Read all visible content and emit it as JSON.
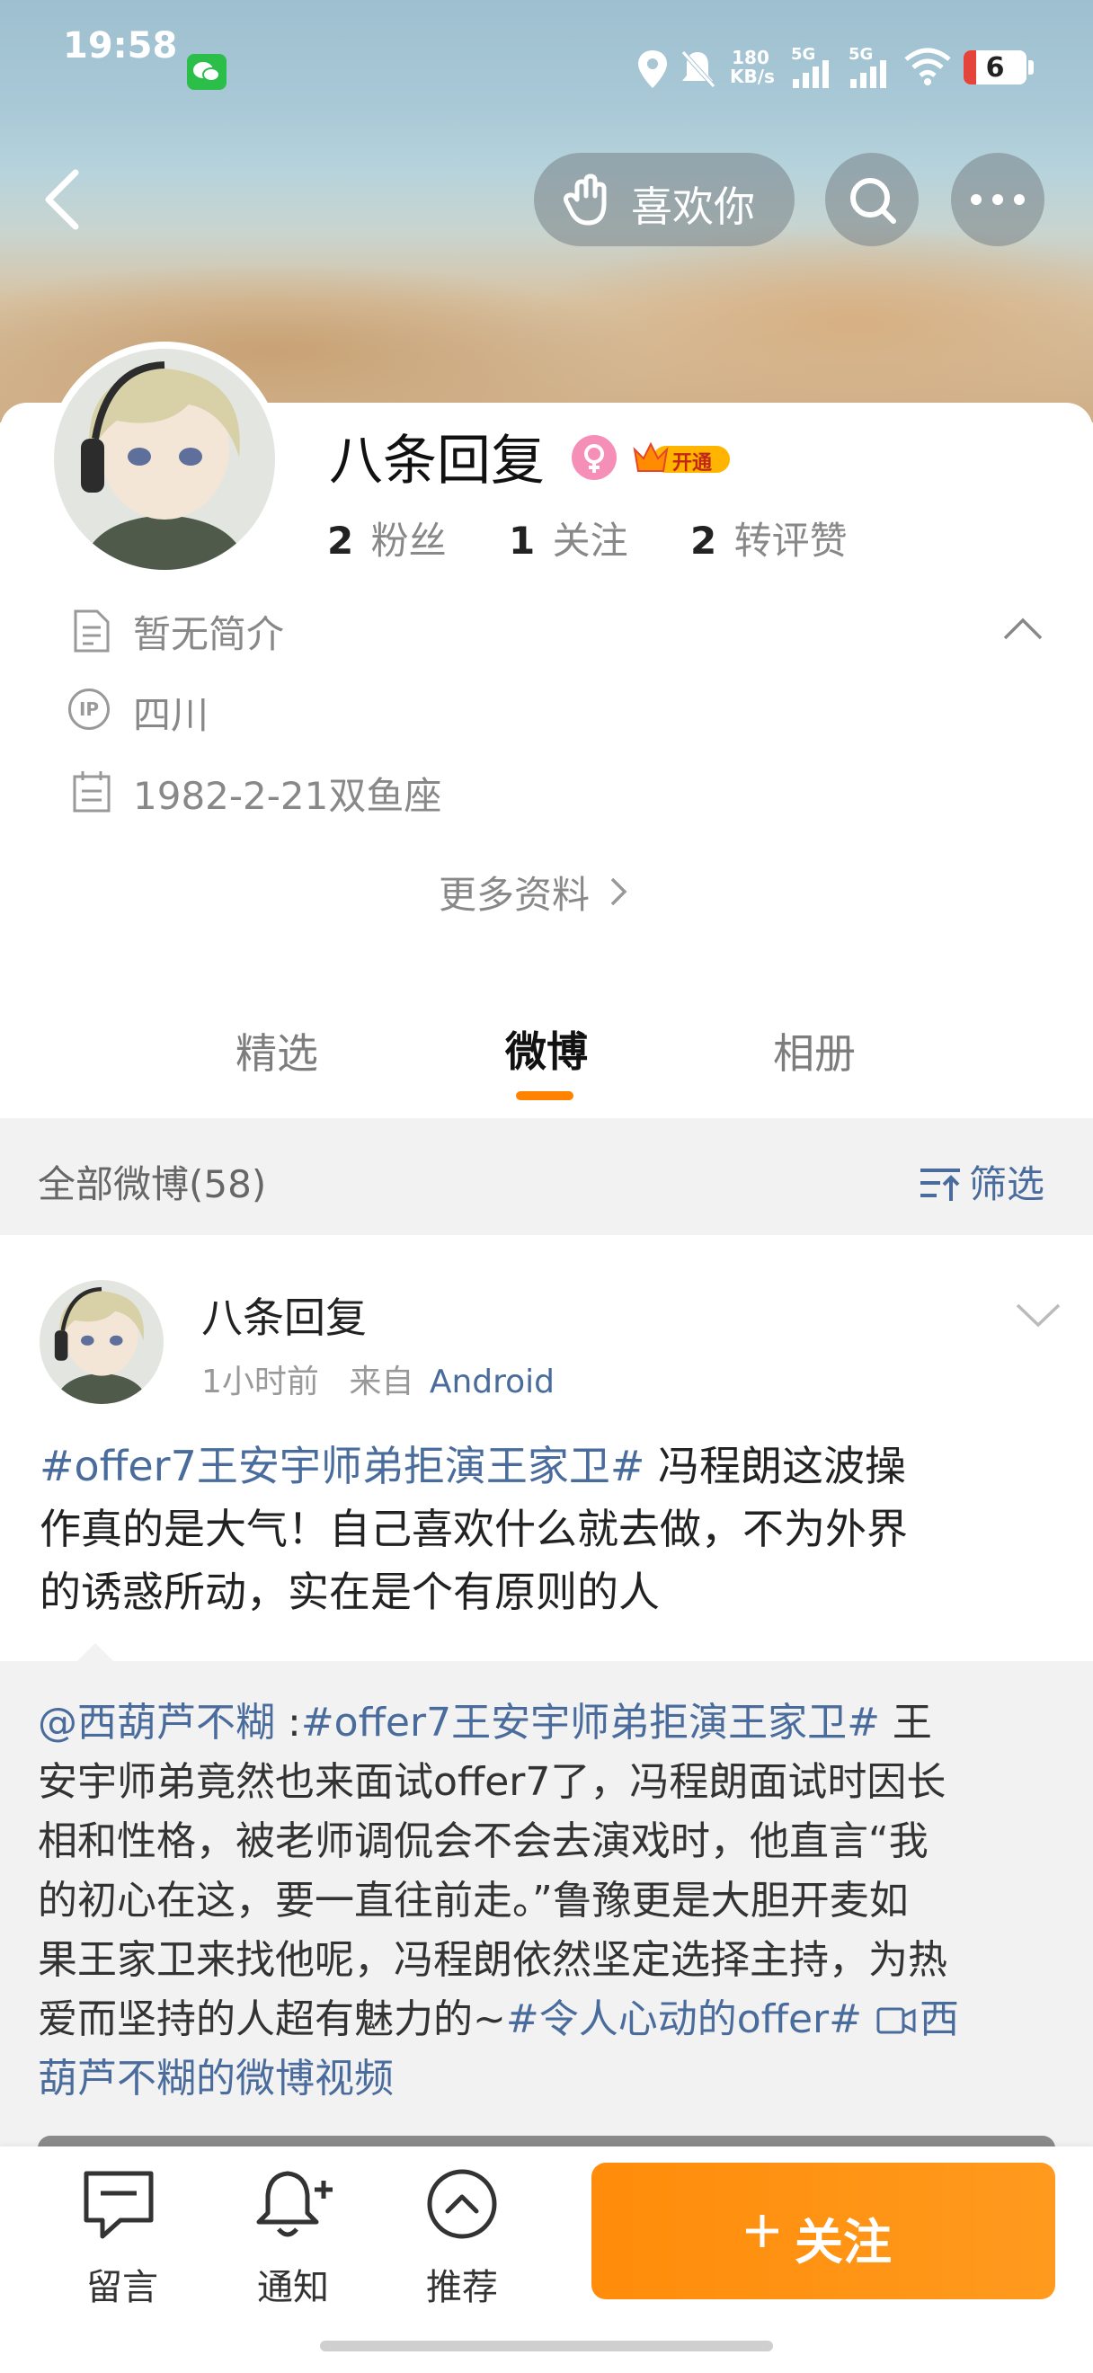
{
  "status_bar": {
    "time": "19:58",
    "speed_top": "180",
    "speed_bottom": "KB/s",
    "net1": "5G",
    "net2": "5G",
    "battery": "6"
  },
  "header": {
    "like_label": "喜欢你"
  },
  "profile": {
    "name": "八条回复",
    "vip_label": "开通",
    "stats": [
      {
        "num": "2",
        "label": "粉丝"
      },
      {
        "num": "1",
        "label": "关注"
      },
      {
        "num": "2",
        "label": "转评赞"
      }
    ],
    "bio": "暂无简介",
    "ip_badge": "IP",
    "location": "四川",
    "birthday": "1982-2-21双鱼座",
    "more_info": "更多资料"
  },
  "tabs": [
    "精选",
    "微博",
    "相册"
  ],
  "feed_header": {
    "title": "全部微博(58)",
    "filter_label": "筛选"
  },
  "post": {
    "author": "八条回复",
    "time": "1小时前",
    "source_prefix": "来自",
    "source": "Android",
    "line1_tag": "#offer7王安宇师弟拒演王家卫#",
    "line1_text": " 冯程朗这波操",
    "line2": "作真的是大气！自己喜欢什么就去做，不为外界",
    "line3": "的诱惑所动，实在是个有原则的人",
    "repost": {
      "mention": "@西葫芦不糊",
      "tag": "#offer7王安宇师弟拒演王家卫#",
      "tail1": " 王",
      "line2": "安宇师弟竟然也来面试offer7了，冯程朗面试时因长",
      "line3": "相和性格，被老师调侃会不会去演戏时，他直言“我",
      "line4": "的初心在这，要一直往前走。”鲁豫更是大胆开麦如",
      "line5": "果王家卫来找他呢，冯程朗依然坚定选择主持，为热",
      "line6_text": "爱而坚持的人超有魅力的~",
      "line6_tag": "#令人心动的offer#",
      "line6_link": "西",
      "line7_link": "葫芦不糊的微博视频"
    }
  },
  "bottom_bar": {
    "items": [
      "留言",
      "通知",
      "推荐"
    ],
    "follow_label": "关注"
  },
  "colors": {
    "accent": "#ff8200",
    "link": "#4a6c9c"
  }
}
